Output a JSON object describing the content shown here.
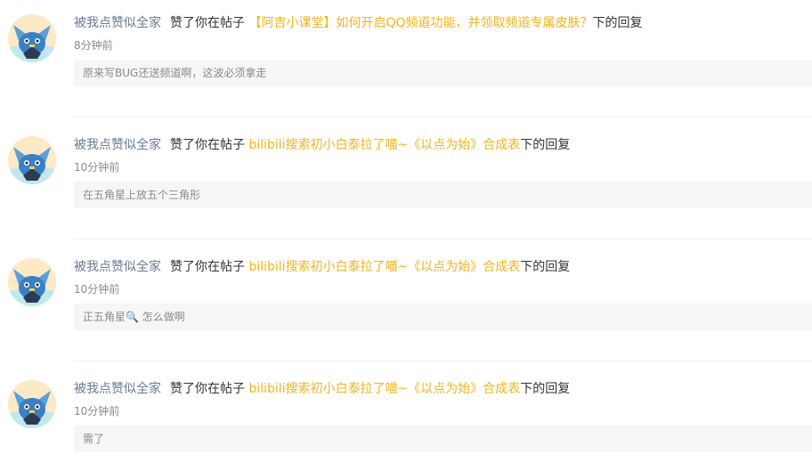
{
  "notifications": [
    {
      "user": "被我点赞似全家",
      "action": "赞了你在帖子",
      "post_title": "【阿吉小课堂】如何开启QQ频道功能，并领取频道专属皮肤？",
      "suffix": "下的回复",
      "time": "8分钟前",
      "reply": "原来写BUG还送频道啊，这波必须拿走"
    },
    {
      "user": "被我点赞似全家",
      "action": "赞了你在帖子",
      "post_title": "bilibili搜索初小白泰拉了喵~《以点为始》合成表",
      "suffix": "下的回复",
      "time": "10分钟前",
      "reply": "在五角星上放五个三角形"
    },
    {
      "user": "被我点赞似全家",
      "action": "赞了你在帖子",
      "post_title": "bilibili搜索初小白泰拉了喵~《以点为始》合成表",
      "suffix": "下的回复",
      "time": "10分钟前",
      "reply": "正五角星🔍 怎么做啊"
    },
    {
      "user": "被我点赞似全家",
      "action": "赞了你在帖子",
      "post_title": "bilibili搜索初小白泰拉了喵~《以点为始》合成表",
      "suffix": "下的回复",
      "time": "10分钟前",
      "reply": "需了"
    }
  ],
  "avatar_icon": "blue-creature-avatar",
  "colors": {
    "username": "#6b7a92",
    "post_link": "#f0b41e",
    "text": "#333333",
    "muted": "#8a8a8a",
    "quote_bg": "#f6f6f6"
  }
}
